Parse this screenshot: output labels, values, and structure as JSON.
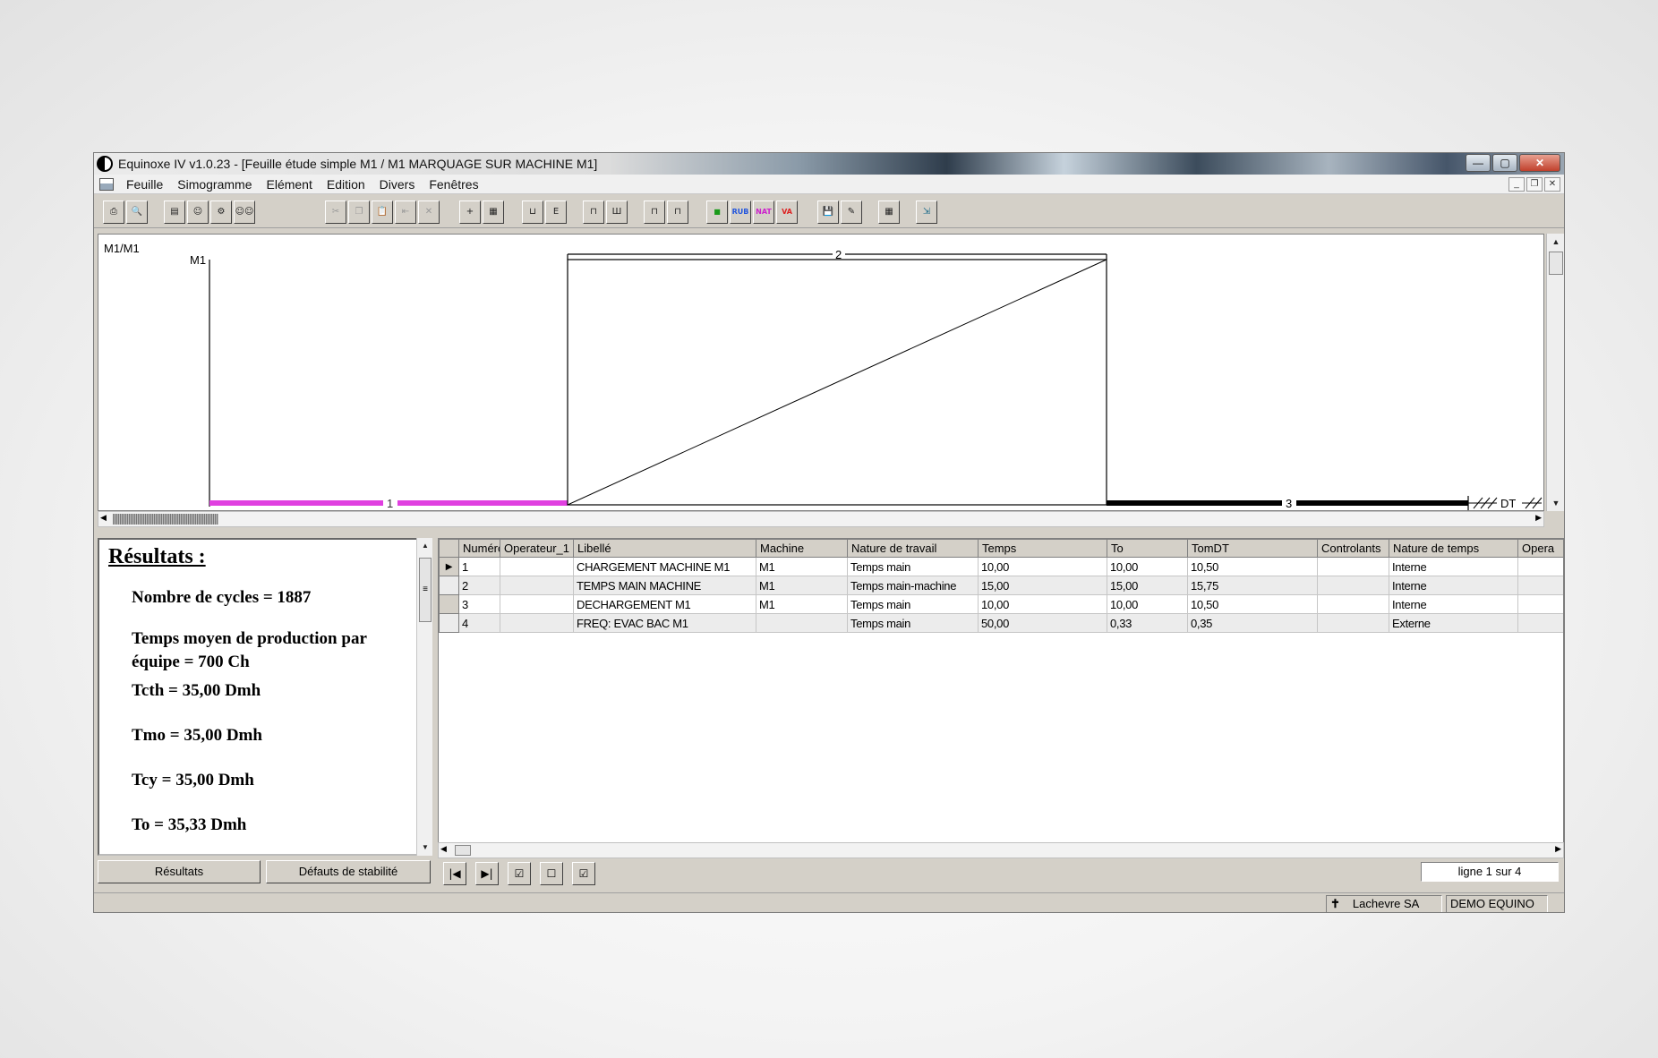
{
  "window": {
    "title": "Equinoxe IV v1.0.23 - [Feuille étude simple M1 / M1   MARQUAGE SUR MACHINE M1]",
    "controls": {
      "minimize": "—",
      "maximize": "▢",
      "close": "✕"
    },
    "mdi_controls": {
      "minimize": "_",
      "restore": "❐",
      "close": "✕"
    }
  },
  "menu": {
    "items": [
      "Feuille",
      "Simogramme",
      "Elément",
      "Edition",
      "Divers",
      "Fenêtres"
    ]
  },
  "toolbar": {
    "buttons": [
      {
        "name": "print-icon",
        "glyph": "⎙"
      },
      {
        "name": "print-preview-icon",
        "glyph": "🔍"
      },
      {
        "name": "sheet-icon",
        "glyph": "▤"
      },
      {
        "name": "operator-icon",
        "glyph": "☺"
      },
      {
        "name": "machine-icon",
        "glyph": "⚙"
      },
      {
        "name": "team-icon",
        "glyph": "☺☺"
      },
      {
        "name": "cut-icon",
        "glyph": "✂"
      },
      {
        "name": "copy-icon",
        "glyph": "❐"
      },
      {
        "name": "paste-icon",
        "glyph": "📋"
      },
      {
        "name": "insert-icon",
        "glyph": "⇤"
      },
      {
        "name": "delete-icon",
        "glyph": "✕"
      },
      {
        "name": "add-element-icon",
        "glyph": "+"
      },
      {
        "name": "properties-icon",
        "glyph": "▦"
      },
      {
        "name": "ruler-h-icon",
        "glyph": "⊔"
      },
      {
        "name": "ruler-v-icon",
        "glyph": "E"
      },
      {
        "name": "scale-1-icon",
        "glyph": "⊓"
      },
      {
        "name": "scale-2-icon",
        "glyph": "Ш"
      },
      {
        "name": "scale-3-icon",
        "glyph": "⊓"
      },
      {
        "name": "scale-4-icon",
        "glyph": "⊓"
      },
      {
        "name": "color-icon",
        "glyph": "■"
      },
      {
        "name": "rub-icon",
        "glyph": "RUB"
      },
      {
        "name": "nat-icon",
        "glyph": "NAT"
      },
      {
        "name": "va-nva-icon",
        "glyph": "VA"
      },
      {
        "name": "save-icon",
        "glyph": "💾"
      },
      {
        "name": "edit-icon",
        "glyph": "✎"
      },
      {
        "name": "table-icon",
        "glyph": "▦"
      },
      {
        "name": "exit-icon",
        "glyph": "⇲"
      }
    ]
  },
  "simogramme": {
    "sheet_label": "M1/M1",
    "machine_label": "M1",
    "segments": [
      {
        "label": "1",
        "color": "#e040e0"
      },
      {
        "label": "2",
        "color": "#000000"
      },
      {
        "label": "3",
        "color": "#000000"
      }
    ],
    "dt_label": "DT"
  },
  "results": {
    "title": "Résultats :",
    "lines": [
      "Nombre de cycles = 1887",
      "Temps moyen de production par équipe = 700 Ch",
      "Tcth = 35,00 Dmh",
      "Tmo = 35,00 Dmh",
      "Tcy = 35,00 Dmh",
      "To = 35,33 Dmh"
    ],
    "tabs": [
      "Résultats",
      "Défauts de stabilité"
    ]
  },
  "grid": {
    "columns": [
      "Numérc",
      "Operateur_1",
      "Libellé",
      "Machine",
      "Nature de travail",
      "Temps",
      "To",
      "TomDT",
      "Controlants",
      "Nature de temps",
      "Opera"
    ],
    "rows": [
      [
        "1",
        "",
        "CHARGEMENT MACHINE M1",
        "M1",
        "Temps main",
        "10,00",
        "10,00",
        "10,50",
        "",
        "Interne",
        ""
      ],
      [
        "2",
        "",
        "TEMPS MAIN MACHINE",
        "M1",
        "Temps main-machine",
        "15,00",
        "15,00",
        "15,75",
        "",
        "Interne",
        ""
      ],
      [
        "3",
        "",
        "DECHARGEMENT M1",
        "M1",
        "Temps main",
        "10,00",
        "10,00",
        "10,50",
        "",
        "Interne",
        ""
      ],
      [
        "4",
        "",
        "FREQ: EVAC BAC M1",
        "",
        "Temps main",
        "50,00",
        "0,33",
        "0,35",
        "",
        "Externe",
        ""
      ]
    ],
    "nav": {
      "first": "|◀",
      "last": "▶|",
      "check": "☑",
      "uncheck": "☐",
      "check2": "☑"
    },
    "row_info": "ligne 1 sur 4"
  },
  "status": {
    "company": "Lachevre SA",
    "user": "DEMO EQUINO"
  }
}
